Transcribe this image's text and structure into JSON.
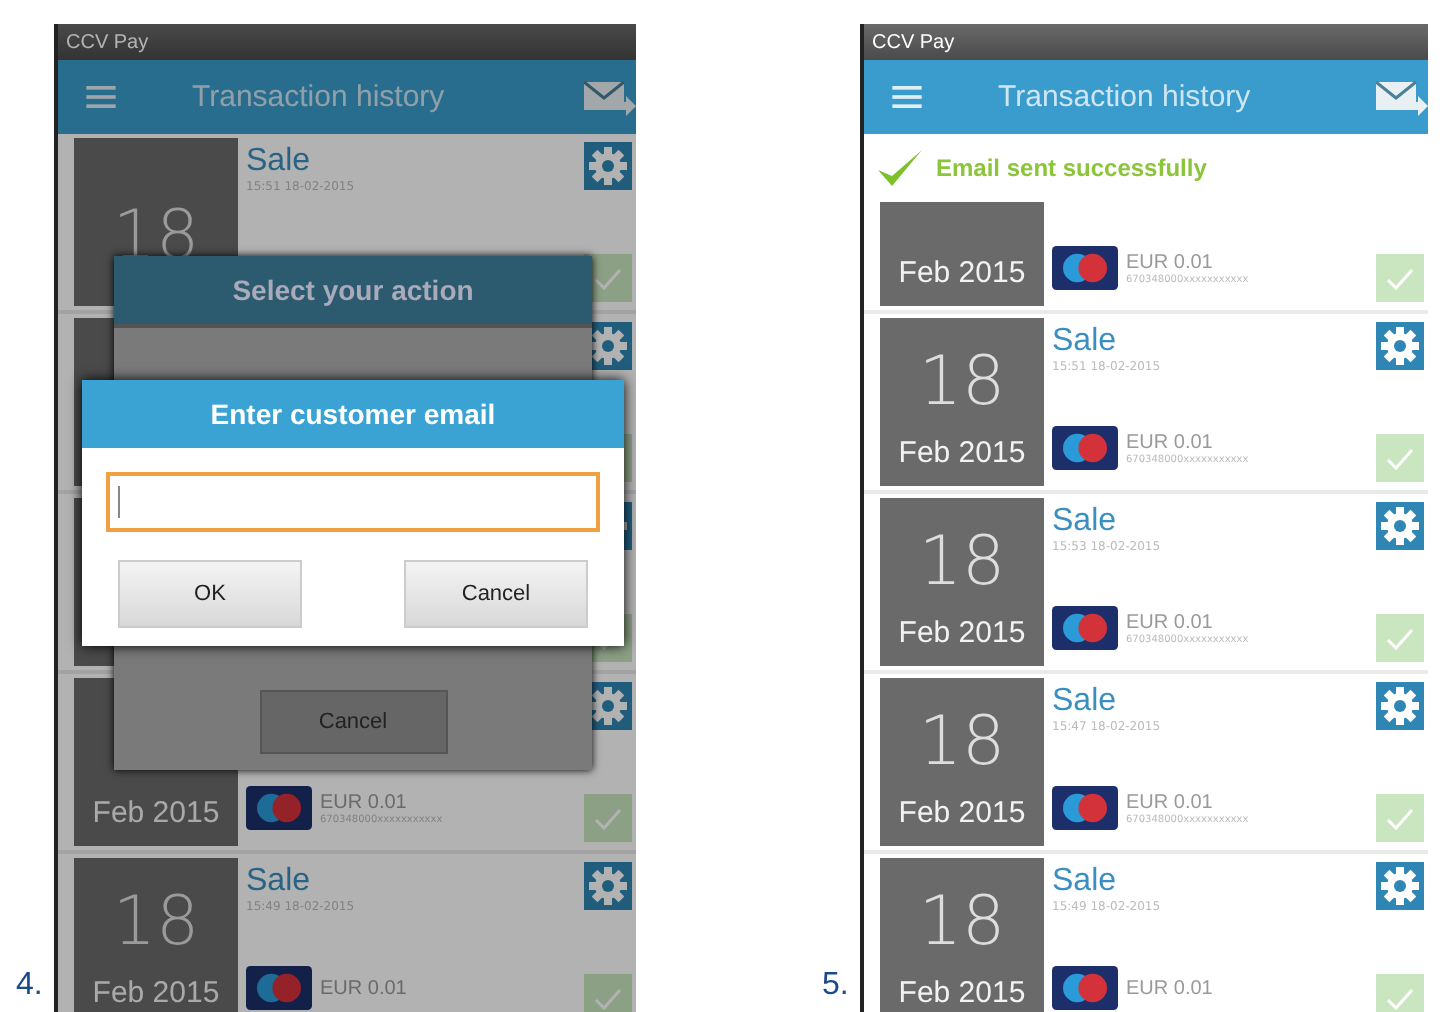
{
  "figures": [
    {
      "label": "4.",
      "status_bar": {
        "title": "CCV Pay"
      },
      "app_bar": {
        "title": "Transaction history"
      },
      "rows": [
        {
          "day": "18",
          "title": "Sale",
          "time": "15:51 18-02-2015"
        },
        {},
        {},
        {
          "month": "Feb 2015",
          "amount": "EUR 0.01",
          "card_number": "670348000xxxxxxxxxxx"
        },
        {
          "day": "18",
          "title": "Sale",
          "time": "15:49 18-02-2015",
          "month": "Feb 2015",
          "amount": "EUR 0.01"
        }
      ],
      "dialogs": [
        {
          "kind": "action",
          "title": "Select your action",
          "buttons": [
            "Cancel"
          ]
        },
        {
          "kind": "email",
          "title": "Enter customer email",
          "buttons": [
            "OK",
            "Cancel"
          ]
        }
      ]
    },
    {
      "label": "5.",
      "status_bar": {
        "title": "CCV Pay"
      },
      "app_bar": {
        "title": "Transaction history"
      },
      "toast": {
        "text": "Email sent successfully"
      },
      "rows": [
        {
          "month": "Feb 2015",
          "amount": "EUR 0.01",
          "card_number": "670348000xxxxxxxxxxx"
        },
        {
          "day": "18",
          "title": "Sale",
          "time": "15:51 18-02-2015",
          "month": "Feb 2015",
          "amount": "EUR 0.01",
          "card_number": "670348000xxxxxxxxxxx"
        },
        {
          "day": "18",
          "title": "Sale",
          "time": "15:53 18-02-2015",
          "month": "Feb 2015",
          "amount": "EUR 0.01",
          "card_number": "670348000xxxxxxxxxxx"
        },
        {
          "day": "18",
          "title": "Sale",
          "time": "15:47 18-02-2015",
          "month": "Feb 2015",
          "amount": "EUR 0.01",
          "card_number": "670348000xxxxxxxxxxx"
        },
        {
          "day": "18",
          "title": "Sale",
          "time": "15:49 18-02-2015",
          "month": "Feb 2015",
          "amount": "EUR 0.01"
        }
      ]
    }
  ]
}
